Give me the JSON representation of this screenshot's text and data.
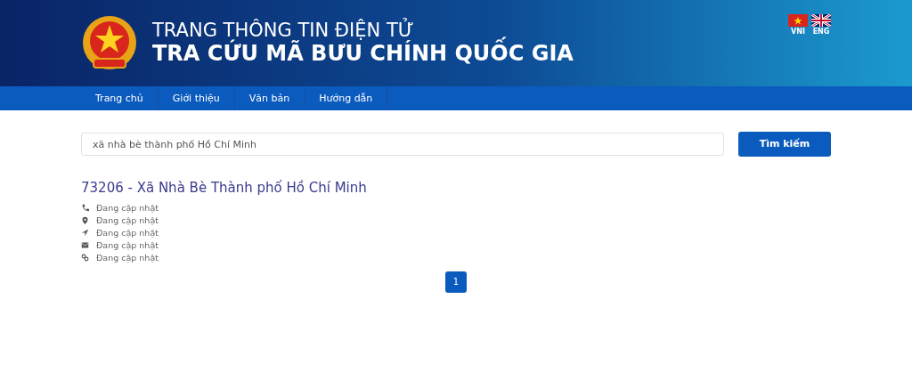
{
  "header": {
    "subtitle": "TRANG THÔNG TIN ĐIỆN TỬ",
    "title": "TRA CỨU MÃ BƯU CHÍNH QUỐC GIA"
  },
  "languages": [
    {
      "kind": "vn",
      "label": "VNI"
    },
    {
      "kind": "uk",
      "label": "ENG"
    }
  ],
  "nav": [
    "Trang chủ",
    "Giới thiệu",
    "Văn bản",
    "Hướng dẫn"
  ],
  "search": {
    "value": "xã nhà bè thành phố Hồ Chí Minh",
    "button": "Tìm kiếm"
  },
  "result": {
    "title": "73206 - Xã Nhà Bè Thành phố Hồ Chí Minh",
    "details": [
      {
        "kind": "phone",
        "text": "Đang cập nhật"
      },
      {
        "kind": "pin",
        "text": "Đang cập nhật"
      },
      {
        "kind": "arrow",
        "text": "Đang cập nhật"
      },
      {
        "kind": "mail",
        "text": "Đang cập nhật"
      },
      {
        "kind": "link",
        "text": "Đang cập nhật"
      }
    ]
  },
  "pagination": [
    {
      "label": "1",
      "selected": true
    }
  ]
}
